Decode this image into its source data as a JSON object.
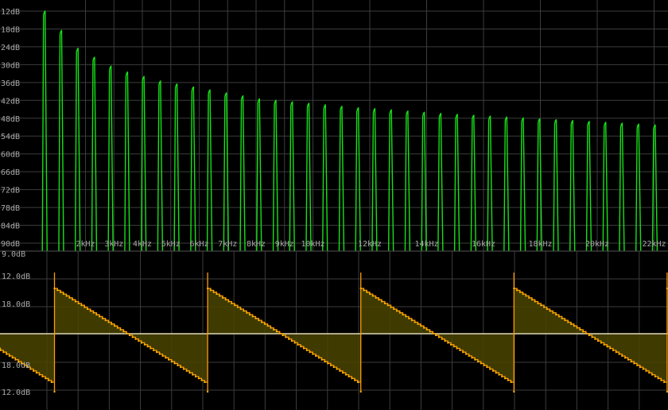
{
  "colors": {
    "background": "#000000",
    "grid": "#3c3c3c",
    "labels": "#a8a8a8",
    "spectrum": "#17e017",
    "wave_line": "#ff9d00",
    "wave_fill": "#4a4400",
    "baseline": "#e0d8b8"
  },
  "chart_data": [
    {
      "type": "line",
      "panel": "spectrum",
      "x_unit": "Hz",
      "y_unit": "dB",
      "ylim": [
        -90,
        -12
      ],
      "grid": true,
      "y_tick_values": [
        -12,
        -18,
        -24,
        -30,
        -36,
        -42,
        -48,
        -54,
        -60,
        -66,
        -72,
        -78,
        -84,
        -90
      ],
      "y_tick_labels": [
        "12dB",
        "18dB",
        "24dB",
        "30dB",
        "36dB",
        "42dB",
        "48dB",
        "54dB",
        "60dB",
        "66dB",
        "72dB",
        "78dB",
        "84dB",
        "90dB"
      ],
      "x_ticks": [
        {
          "hz": 2000,
          "label": "2kHz"
        },
        {
          "hz": 3000,
          "label": "3kHz"
        },
        {
          "hz": 4000,
          "label": "4kHz"
        },
        {
          "hz": 5000,
          "label": "5kHz"
        },
        {
          "hz": 6000,
          "label": "6kHz"
        },
        {
          "hz": 7000,
          "label": "7kHz"
        },
        {
          "hz": 8000,
          "label": "8kHz"
        },
        {
          "hz": 9000,
          "label": "9kHz"
        },
        {
          "hz": 10000,
          "label": "10kHz"
        },
        {
          "hz": 12000,
          "label": "12kHz"
        },
        {
          "hz": 14000,
          "label": "14kHz"
        },
        {
          "hz": 16000,
          "label": "16kHz"
        },
        {
          "hz": 18000,
          "label": "18kHz"
        },
        {
          "hz": 20000,
          "label": "20kHz"
        },
        {
          "hz": 22000,
          "label": "22kHz"
        }
      ],
      "harmonic_peaks_db": [
        -12,
        -18.5,
        -24.5,
        -27.5,
        -30.5,
        -32.5,
        -34,
        -35.5,
        -36.5,
        -37.5,
        -38.5,
        -39.5,
        -40.5,
        -41.5,
        -42,
        -42.5,
        -43,
        -43.5,
        -44,
        -44.5,
        -44.8,
        -45.2,
        -45.6,
        -46,
        -46.4,
        -46.7,
        -47,
        -47.3,
        -47.6,
        -47.9,
        -48.2,
        -48.5,
        -48.8,
        -49.1,
        -49.4,
        -49.7,
        -50,
        -50.3,
        -50.6
      ]
    },
    {
      "type": "area",
      "panel": "waveform",
      "y_unit": "dB",
      "grid": true,
      "y_tick_labels": [
        "9.0dB",
        "12.0dB",
        "18.0dB",
        "18.0dB",
        "12.0dB"
      ],
      "waveform": "sawtooth",
      "cycles": 4,
      "steps_per_cycle": 51
    }
  ]
}
